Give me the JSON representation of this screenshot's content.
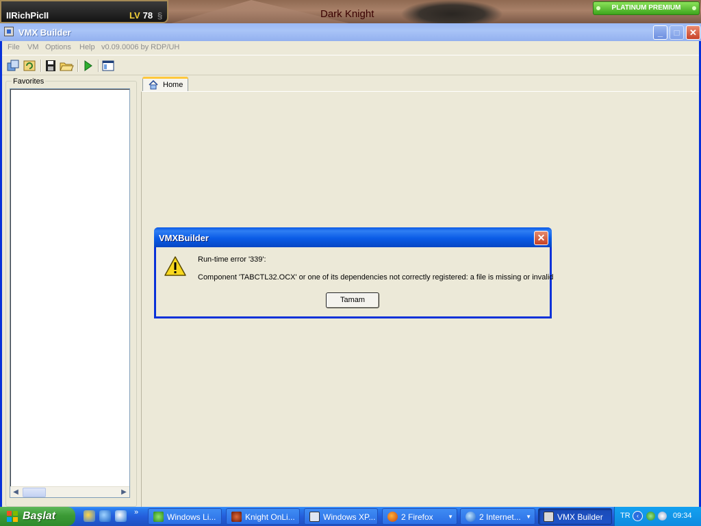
{
  "game": {
    "player_name": "IIRichPicII",
    "level_label": "LV",
    "level": "78",
    "title": "Dark Knight",
    "premium": "PLATINUM PREMIUM"
  },
  "window": {
    "title": "VMX Builder",
    "menu": [
      "File",
      "VM",
      "Options",
      "Help",
      "v0.09.0006 by RDP/UH"
    ],
    "toolbar_icons": [
      "vm-list-icon",
      "refresh-icon",
      "save-icon",
      "open-folder-icon",
      "run-icon",
      "layout-icon"
    ],
    "favorites_label": "Favorites",
    "home_tab": "Home"
  },
  "dialog": {
    "title": "VMXBuilder",
    "line1": "Run-time error '339':",
    "line2": "Component 'TABCTL32.OCX' or one of its dependencies not correctly registered: a file is missing or invalid",
    "ok_button": "Tamam",
    "icon": "warning-icon"
  },
  "taskbar": {
    "start": "Başlat",
    "tasks": [
      {
        "label": "Windows Li...",
        "icon": "messenger-icon"
      },
      {
        "label": "Knight OnLi...",
        "icon": "knight-online-icon"
      },
      {
        "label": "Windows XP...",
        "icon": "window-icon"
      },
      {
        "label": "2 Firefox",
        "icon": "firefox-icon"
      },
      {
        "label": "2 Internet...",
        "icon": "ie-icon"
      },
      {
        "label": "VMX Builder",
        "icon": "vmx-icon"
      }
    ],
    "lang": "TR",
    "clock": "09:34"
  },
  "colors": {
    "xp_blue": "#0831d9",
    "taskbar": "#245edb",
    "start_green": "#3c9a36",
    "dialog_bg": "#ece9d8"
  }
}
